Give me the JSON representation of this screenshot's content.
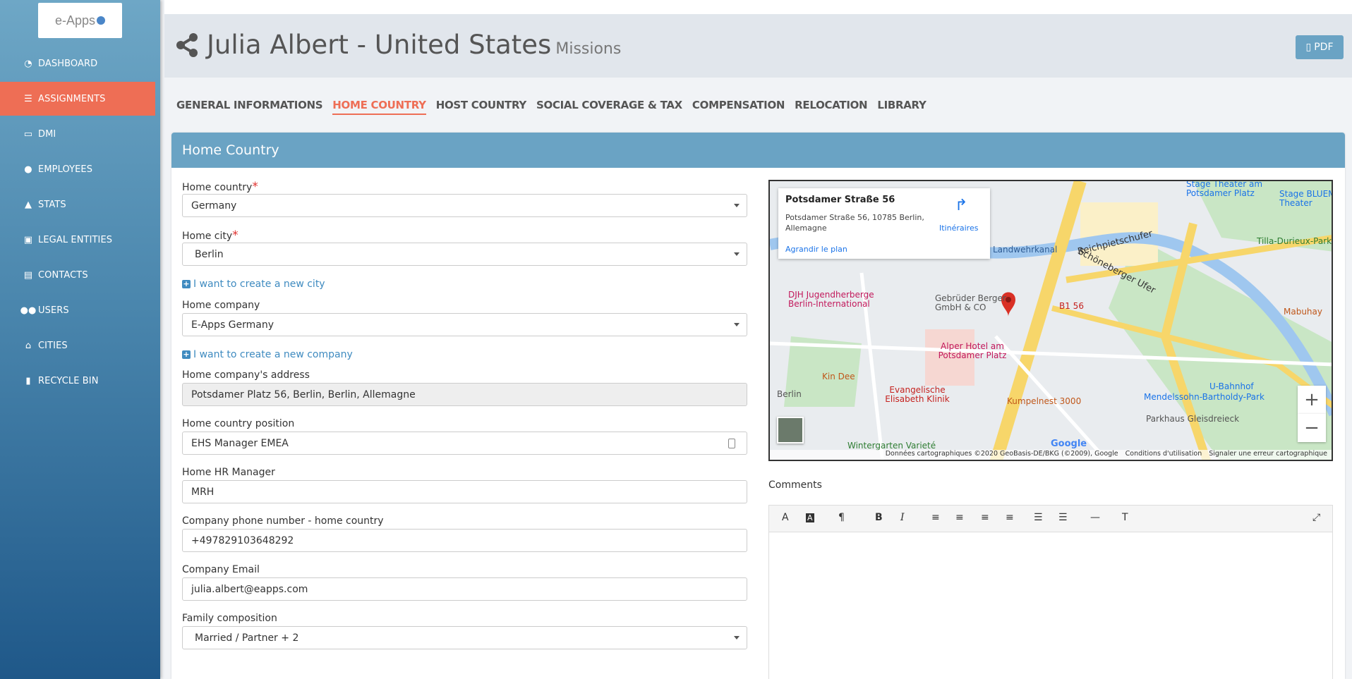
{
  "logo": {
    "text": "e-Apps"
  },
  "sidebar": {
    "items": [
      {
        "label": "DASHBOARD",
        "icon": "dashboard-icon"
      },
      {
        "label": "ASSIGNMENTS",
        "icon": "assignments-icon",
        "active": true
      },
      {
        "label": "DMI",
        "icon": "dmi-icon"
      },
      {
        "label": "EMPLOYEES",
        "icon": "employees-icon"
      },
      {
        "label": "STATS",
        "icon": "stats-icon"
      },
      {
        "label": "LEGAL ENTITIES",
        "icon": "legal-entities-icon"
      },
      {
        "label": "CONTACTS",
        "icon": "contacts-icon"
      },
      {
        "label": "USERS",
        "icon": "users-icon"
      },
      {
        "label": "CITIES",
        "icon": "cities-icon"
      },
      {
        "label": "RECYCLE BIN",
        "icon": "trash-icon"
      }
    ]
  },
  "header": {
    "title": "Julia Albert - United States",
    "subtitle": "Missions",
    "pdf_label": "PDF"
  },
  "tabs": [
    {
      "label": "GENERAL INFORMATIONS"
    },
    {
      "label": "HOME COUNTRY",
      "active": true
    },
    {
      "label": "HOST COUNTRY"
    },
    {
      "label": "SOCIAL COVERAGE & TAX"
    },
    {
      "label": "COMPENSATION"
    },
    {
      "label": "RELOCATION"
    },
    {
      "label": "LIBRARY"
    }
  ],
  "panel": {
    "title": "Home Country"
  },
  "form": {
    "home_country": {
      "label": "Home country",
      "value": "Germany"
    },
    "home_city": {
      "label": "Home city",
      "value": "Berlin"
    },
    "new_city_link": "I want to create a new city",
    "home_company": {
      "label": "Home company",
      "value": "E-Apps Germany"
    },
    "new_company_link": "I want to create a new company",
    "company_address": {
      "label": "Home company's address",
      "value": "Potsdamer Platz 56, Berlin, Berlin, Allemagne"
    },
    "position": {
      "label": "Home country position",
      "value": "EHS Manager EMEA"
    },
    "hr_manager": {
      "label": "Home HR Manager",
      "value": "MRH"
    },
    "phone": {
      "label": "Company phone number - home country",
      "value": "+497829103648292"
    },
    "email": {
      "label": "Company Email",
      "value": "julia.albert@eapps.com"
    },
    "family": {
      "label": "Family composition",
      "value": "Married / Partner + 2"
    }
  },
  "map": {
    "info_title": "Potsdamer Straße 56",
    "info_address": "Potsdamer Straße 56, 10785 Berlin, Allemagne",
    "info_enlarge": "Agrandir le plan",
    "info_directions": "Itinéraires",
    "labels": {
      "stage_theater": "Stage Theater am Potsdamer Platz",
      "bluemaxx": "Stage BLUEMAXX Theater",
      "landwehrkanal": "Landwehrkanal",
      "reichpietschufer": "Reichpietschufer",
      "schoneberger": "Schöneberger Ufer",
      "tilla": "Tilla-Durieux-Park",
      "djh": "DJH Jugendherberge Berlin-International",
      "gebruder": "Gebrüder Berger GmbH & CO",
      "b156": "B1 56",
      "alper": "Alper Hotel am Potsdamer Platz",
      "kindee": "Kin Dee",
      "evangelische": "Evangelische Elisabeth Klinik",
      "kumpelnest": "Kumpelnest 3000",
      "ubahnhof": "U-Bahnhof",
      "mendelssohn": "Mendelssohn-Bartholdy-Park",
      "parkhaus": "Parkhaus Gleisdreieck",
      "mabuhay": "Mabuhay",
      "wintergarten": "Wintergarten Varieté",
      "berlin": "Berlin",
      "google": "Google"
    },
    "footer": [
      "Données cartographiques ©2020 GeoBasis-DE/BKG (©2009), Google",
      "Conditions d'utilisation",
      "Signaler une erreur cartographique"
    ]
  },
  "comments": {
    "label": "Comments"
  }
}
